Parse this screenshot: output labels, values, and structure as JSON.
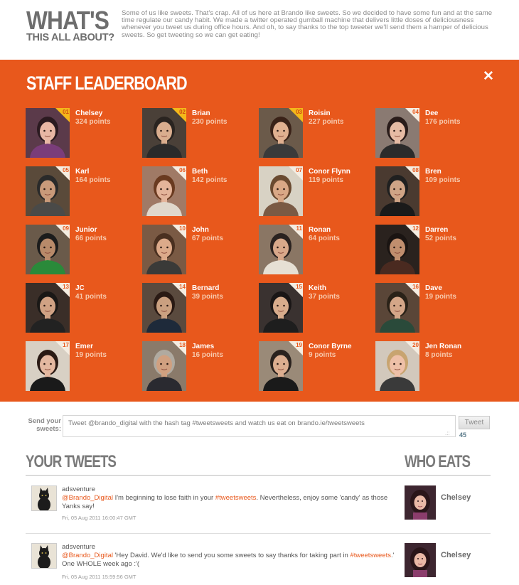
{
  "intro": {
    "title_line1": "WHAT'S",
    "title_line2": "THIS ALL ABOUT?",
    "text": "Some of us like sweets. That's crap. All of us here at Brando like sweets. So we decided to have some fun and at the same time regulate our candy habit. We made a twitter operated gumball machine that delivers little doses of deliciousness whenever you tweet us during office hours. And oh, to say thanks to the top tweeter we'll send them a hamper of delicious sweets. So get tweeting so we can get eating!"
  },
  "board": {
    "title": "STAFF LEADERBOARD",
    "close_icon": "✕",
    "staff": [
      {
        "rank": "01",
        "name": "Chelsey",
        "points": "324 points",
        "gold": true,
        "palette": "a"
      },
      {
        "rank": "02",
        "name": "Brian",
        "points": "230 points",
        "gold": true,
        "palette": "b"
      },
      {
        "rank": "03",
        "name": "Roisin",
        "points": "227 points",
        "gold": true,
        "palette": "c"
      },
      {
        "rank": "04",
        "name": "Dee",
        "points": "176 points",
        "gold": false,
        "palette": "d"
      },
      {
        "rank": "05",
        "name": "Karl",
        "points": "164 points",
        "gold": false,
        "palette": "e"
      },
      {
        "rank": "06",
        "name": "Beth",
        "points": "142 points",
        "gold": false,
        "palette": "f"
      },
      {
        "rank": "07",
        "name": "Conor Flynn",
        "points": "119 points",
        "gold": false,
        "palette": "g"
      },
      {
        "rank": "08",
        "name": "Bren",
        "points": "109 points",
        "gold": false,
        "palette": "h"
      },
      {
        "rank": "09",
        "name": "Junior",
        "points": "66 points",
        "gold": false,
        "palette": "i"
      },
      {
        "rank": "10",
        "name": "John",
        "points": "67 points",
        "gold": false,
        "palette": "j"
      },
      {
        "rank": "11",
        "name": "Ronan",
        "points": "64 points",
        "gold": false,
        "palette": "k"
      },
      {
        "rank": "12",
        "name": "Darren",
        "points": "52 points",
        "gold": false,
        "palette": "l"
      },
      {
        "rank": "13",
        "name": "JC",
        "points": "41 points",
        "gold": false,
        "palette": "m"
      },
      {
        "rank": "14",
        "name": "Bernard",
        "points": "39 points",
        "gold": false,
        "palette": "n"
      },
      {
        "rank": "15",
        "name": "Keith",
        "points": "37 points",
        "gold": false,
        "palette": "o"
      },
      {
        "rank": "16",
        "name": "Dave",
        "points": "19 points",
        "gold": false,
        "palette": "p"
      },
      {
        "rank": "17",
        "name": "Emer",
        "points": "19 points",
        "gold": false,
        "palette": "q"
      },
      {
        "rank": "18",
        "name": "James",
        "points": "16 points",
        "gold": false,
        "palette": "r"
      },
      {
        "rank": "19",
        "name": "Conor Byrne",
        "points": "9 points",
        "gold": false,
        "palette": "s"
      },
      {
        "rank": "20",
        "name": "Jen Ronan",
        "points": "8 points",
        "gold": false,
        "palette": "t"
      }
    ]
  },
  "send": {
    "label": "Send your sweets:",
    "value": "Tweet @brando_digital with the hash tag #tweetsweets and watch us eat on brando.ie/tweetsweets",
    "button": "Tweet",
    "counter": "45"
  },
  "tweets_section": {
    "title": "YOUR TWEETS",
    "eats_title": "WHO EATS",
    "items": [
      {
        "user": "adsventure",
        "mention": "@Brando_Digital",
        "text_before": " I'm beginning to lose faith in your ",
        "hashtag": "#tweetsweets",
        "text_after": ". Nevertheless, enjoy some 'candy' as those Yanks say!",
        "date": "Fri, 05 Aug 2011 16:00:47 GMT",
        "eater": "Chelsey"
      },
      {
        "user": "adsventure",
        "mention": "@Brando_Digital",
        "text_before": " 'Hey David. We'd like to send you some sweets to say thanks for taking part in ",
        "hashtag": "#tweetsweets",
        "text_after": ".' One WHOLE week ago :'(",
        "date": "Fri, 05 Aug 2011 15:59:56 GMT",
        "eater": "Chelsey"
      }
    ]
  }
}
